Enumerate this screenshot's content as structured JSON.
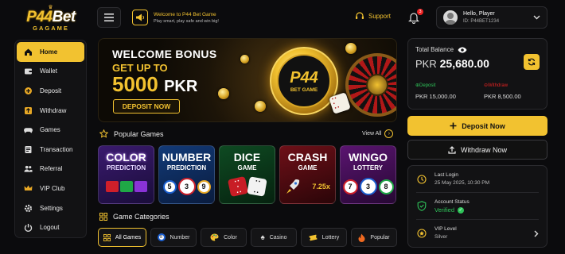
{
  "logo": {
    "part1": "P44",
    "part2": "Bet",
    "sub": "GAGAME"
  },
  "announcement": {
    "title": "Welcome to P44 Bet Game",
    "subtitle": "Play smart, play safe and win big!"
  },
  "support_label": "Support",
  "notifications_count": "3",
  "user": {
    "greeting": "Hello, Player",
    "id": "ID: P44BET1234"
  },
  "sidebar": {
    "items": [
      {
        "label": "Home",
        "icon": "home-icon"
      },
      {
        "label": "Wallet",
        "icon": "wallet-icon"
      },
      {
        "label": "Deposit",
        "icon": "deposit-icon"
      },
      {
        "label": "Withdraw",
        "icon": "withdraw-icon"
      },
      {
        "label": "Games",
        "icon": "gamepad-icon"
      },
      {
        "label": "Transaction",
        "icon": "transaction-icon"
      },
      {
        "label": "Referral",
        "icon": "referral-icon"
      },
      {
        "label": "VIP Club",
        "icon": "crown-icon"
      },
      {
        "label": "Settings",
        "icon": "gear-icon"
      },
      {
        "label": "Logout",
        "icon": "power-icon"
      }
    ]
  },
  "banner": {
    "title": "WELCOME BONUS",
    "line2": "GET UP TO",
    "amount": "5000",
    "currency": "PKR",
    "button": "DEPOSIT NOW",
    "coin_title": "P44",
    "coin_sub": "BET GAME"
  },
  "popular": {
    "title": "Popular Games",
    "view_all": "View All",
    "games": [
      {
        "t1": "COLOR",
        "t2": "PREDICTION",
        "art": ""
      },
      {
        "t1": "NUMBER",
        "t2": "PREDICTION",
        "art": ""
      },
      {
        "t1": "DICE",
        "t2": "GAME",
        "art": ""
      },
      {
        "t1": "CRASH",
        "t2": "GAME",
        "art": "7.25x"
      },
      {
        "t1": "WINGO",
        "t2": "LOTTERY",
        "art": ""
      }
    ],
    "balls_number": [
      "5",
      "3",
      "9"
    ],
    "balls_wingo": [
      "7",
      "3",
      "8"
    ]
  },
  "categories": {
    "title": "Game Categories",
    "items": [
      {
        "label": "All Games",
        "icon": "grid-icon"
      },
      {
        "label": "Number",
        "icon": "number-ball-icon"
      },
      {
        "label": "Color",
        "icon": "palette-icon"
      },
      {
        "label": "Casino",
        "icon": "spade-icon"
      },
      {
        "label": "Lottery",
        "icon": "ticket-icon"
      },
      {
        "label": "Popular",
        "icon": "fire-icon"
      }
    ]
  },
  "balance": {
    "label": "Total Balance",
    "currency": "PKR",
    "amount": "25,680.00",
    "deposit_label": "Deposit",
    "deposit_value": "PKR 15,000.00",
    "withdraw_label": "Withdraw",
    "withdraw_value": "PKR 8,500.00"
  },
  "actions": {
    "deposit": "Deposit Now",
    "withdraw": "Withdraw Now"
  },
  "info": {
    "last_login_label": "Last Login",
    "last_login_value": "25 May 2025, 10:30 PM",
    "status_label": "Account Status",
    "status_value": "Verified",
    "vip_label": "VIP Level",
    "vip_value": "Silver"
  },
  "colors": {
    "accent": "#f2c230",
    "background": "#0b0b0d",
    "panel": "#121214",
    "success": "#2fc45a",
    "danger": "#e22222"
  }
}
